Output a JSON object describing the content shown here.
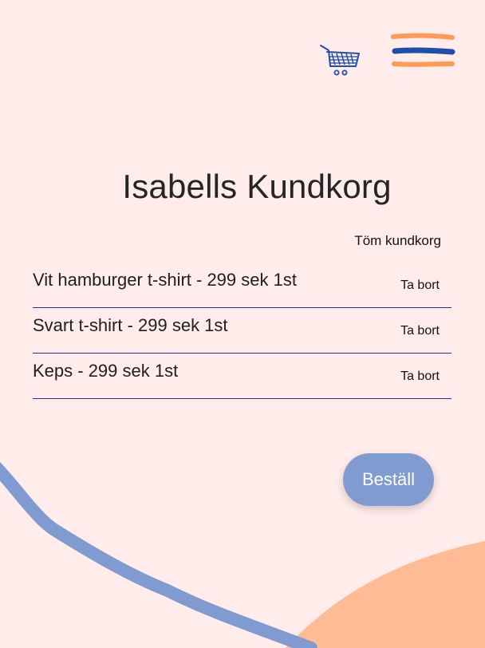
{
  "header": {
    "cart_icon": "shopping-cart-icon",
    "menu_icon": "hamburger-menu-icon"
  },
  "page": {
    "title": "Isabells Kundkorg",
    "empty_cart_label": "Töm kundkorg"
  },
  "cart": {
    "items": [
      {
        "text": "Vit hamburger t-shirt - 299 sek 1st",
        "remove_label": "Ta bort"
      },
      {
        "text": "Svart t-shirt - 299 sek 1st",
        "remove_label": "Ta bort"
      },
      {
        "text": "Keps - 299 sek 1st",
        "remove_label": "Ta bort"
      }
    ]
  },
  "actions": {
    "order_label": "Beställ"
  },
  "colors": {
    "background": "#ffeceb",
    "accent_blue": "#7f9bcf",
    "accent_orange": "#ffbc94",
    "menu_blue": "#1f4fa8",
    "menu_orange": "#ff9a55",
    "divider": "#2a2aa8"
  }
}
